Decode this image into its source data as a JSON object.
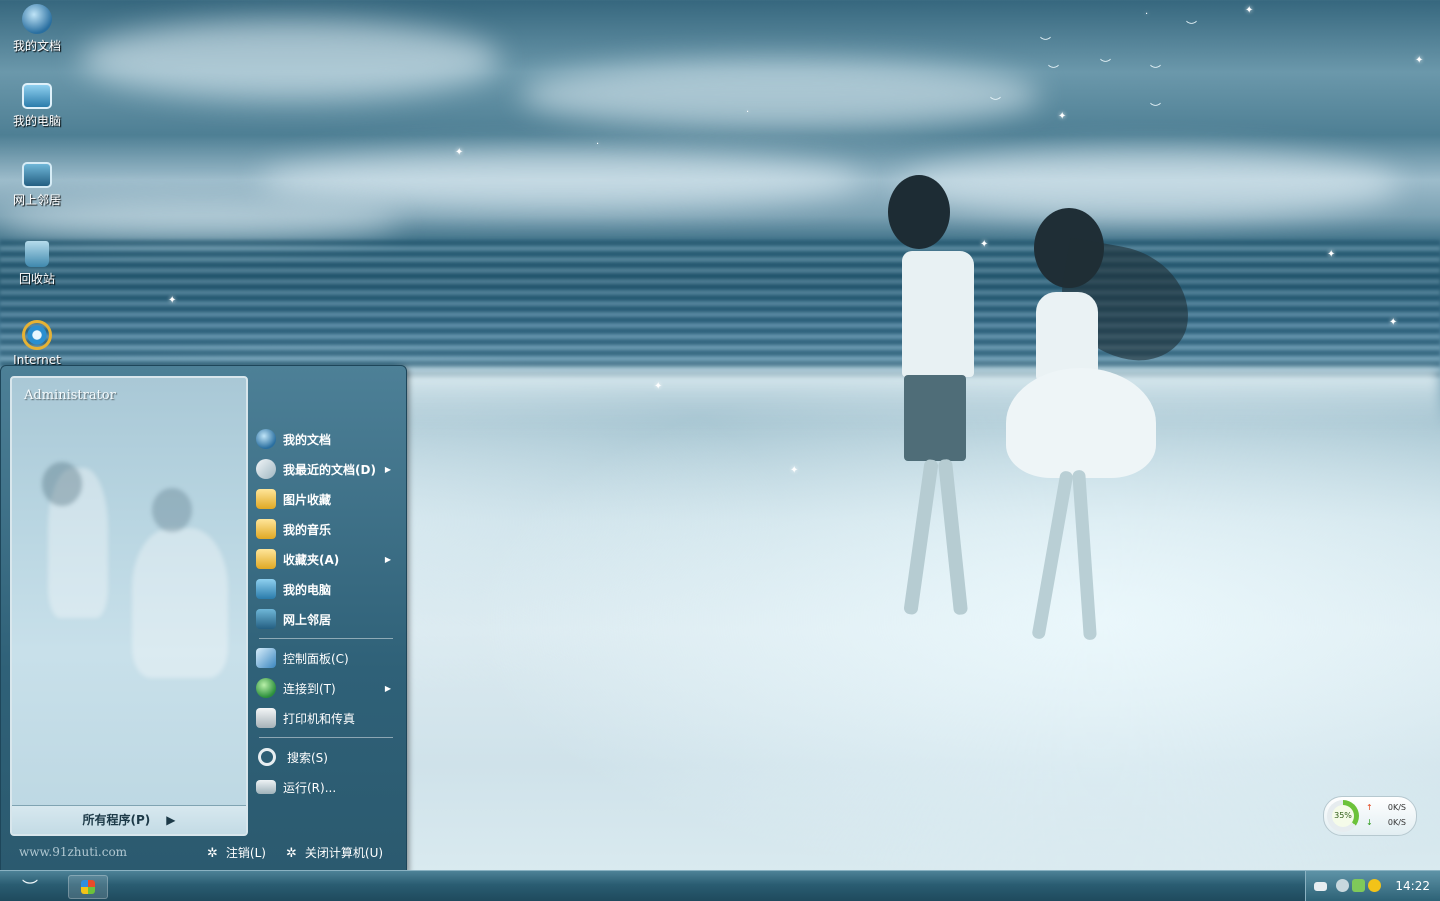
{
  "desktop": {
    "icons": [
      {
        "label": "我的文档",
        "icon": "my-documents-icon"
      },
      {
        "label": "我的电脑",
        "icon": "my-computer-icon"
      },
      {
        "label": "网上邻居",
        "icon": "network-places-icon"
      },
      {
        "label": "回收站",
        "icon": "recycle-bin-icon"
      },
      {
        "label": "Internet",
        "icon": "internet-explorer-icon"
      }
    ]
  },
  "start_menu": {
    "user": "Administrator",
    "all_programs": "所有程序(P)",
    "items": [
      {
        "label": "我的文档",
        "icon": "my-documents-icon"
      },
      {
        "label": "我最近的文档(D)",
        "icon": "recent-documents-icon"
      },
      {
        "label": "图片收藏",
        "icon": "pictures-folder-icon"
      },
      {
        "label": "我的音乐",
        "icon": "music-folder-icon"
      },
      {
        "label": "收藏夹(A)",
        "icon": "favorites-folder-icon"
      },
      {
        "label": "我的电脑",
        "icon": "my-computer-icon"
      },
      {
        "label": "网上邻居",
        "icon": "network-places-icon"
      },
      {
        "label": "控制面板(C)",
        "icon": "control-panel-icon"
      },
      {
        "label": "连接到(T)",
        "icon": "connect-to-icon"
      },
      {
        "label": "打印机和传真",
        "icon": "printer-icon"
      },
      {
        "label": "搜索(S)",
        "icon": "search-icon"
      },
      {
        "label": "运行(R)...",
        "icon": "run-icon"
      }
    ],
    "footer": {
      "url": "www.91zhuti.com",
      "logoff": "注销(L)",
      "shutdown": "关闭计算机(U)"
    }
  },
  "net_monitor": {
    "percent": "35%",
    "up": "0K/S",
    "down": "0K/S"
  },
  "taskbar": {
    "clock": "14:22"
  }
}
